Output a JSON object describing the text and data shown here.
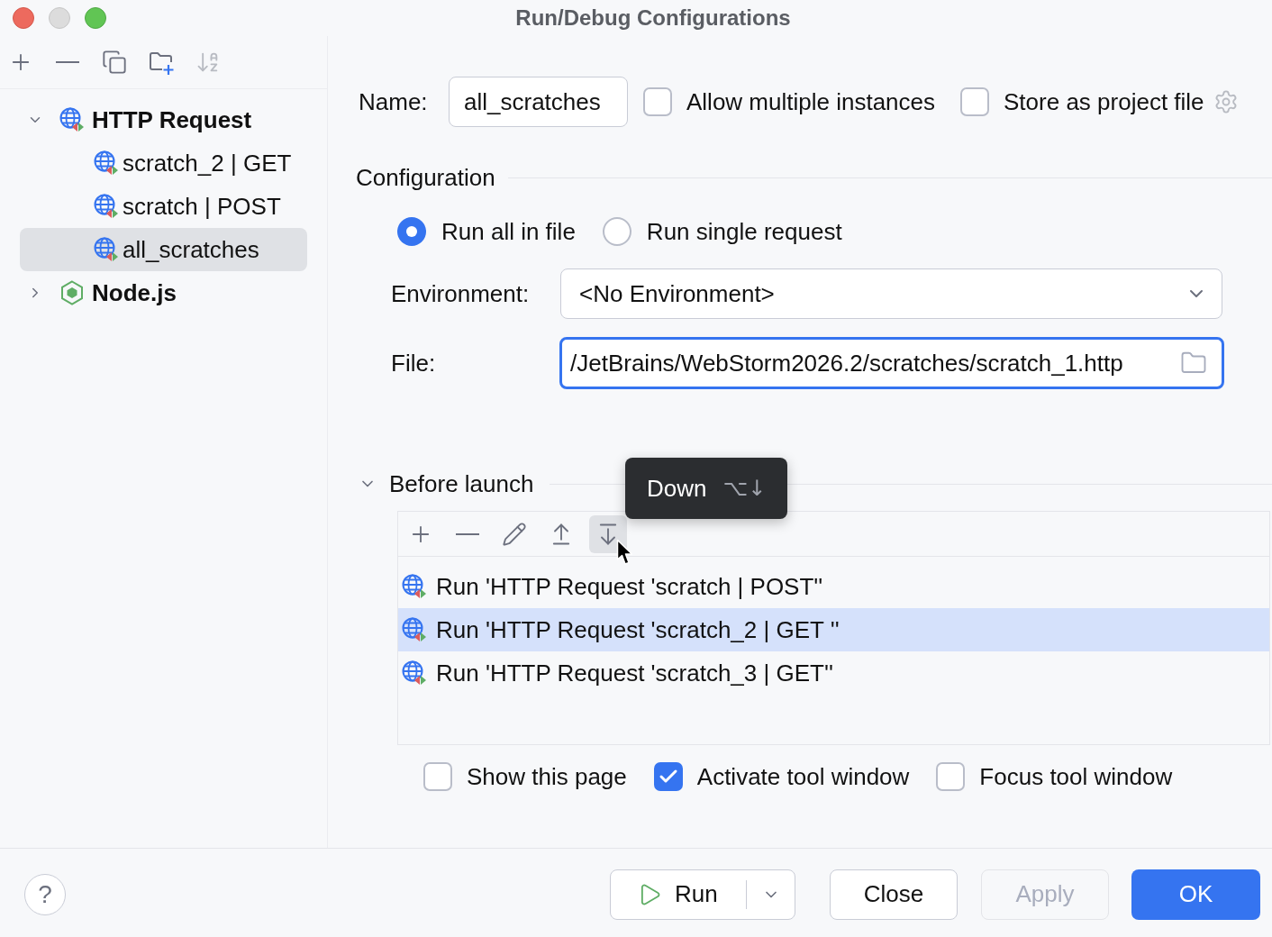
{
  "window": {
    "title": "Run/Debug Configurations"
  },
  "sidebar": {
    "toolbar": [
      {
        "kind": "add",
        "disabled": false
      },
      {
        "kind": "remove",
        "disabled": false
      },
      {
        "kind": "copy",
        "disabled": false
      },
      {
        "kind": "new-folder",
        "disabled": false
      },
      {
        "kind": "sort",
        "disabled": true
      }
    ],
    "tree": [
      {
        "kind": "http",
        "label": "HTTP Request",
        "expanded": true,
        "selected": false,
        "children": [
          {
            "kind": "http",
            "label": "scratch_2 | GET",
            "selected": false
          },
          {
            "kind": "http",
            "label": "scratch | POST",
            "selected": false
          },
          {
            "kind": "http",
            "label": "all_scratches",
            "selected": true
          }
        ]
      },
      {
        "kind": "nodejs",
        "label": "Node.js",
        "expanded": false,
        "selected": false
      }
    ]
  },
  "name_row": {
    "label": "Name:",
    "value": "all_scratches",
    "options": [
      {
        "label": "Allow multiple instances",
        "checked": false
      },
      {
        "label": "Store as project file",
        "checked": false
      }
    ]
  },
  "configuration": {
    "title": "Configuration",
    "modes": [
      {
        "label": "Run all in file",
        "selected": true
      },
      {
        "label": "Run single request",
        "selected": false
      }
    ],
    "environment": {
      "label": "Environment:",
      "value": "<No Environment>"
    },
    "file": {
      "label": "File:",
      "value": "/JetBrains/WebStorm2026.2/scratches/scratch_1.http",
      "focused": true
    }
  },
  "before_launch": {
    "title": "Before launch",
    "expanded": true,
    "toolbar": [
      {
        "kind": "add",
        "hovered": false
      },
      {
        "kind": "remove",
        "hovered": false
      },
      {
        "kind": "edit",
        "hovered": false
      },
      {
        "kind": "move-up",
        "hovered": false
      },
      {
        "kind": "move-down",
        "hovered": true
      }
    ],
    "tooltip": {
      "label": "Down",
      "shortcut": "⌥↓"
    },
    "tasks": [
      {
        "label": "Run 'HTTP Request 'scratch | POST''",
        "selected": false
      },
      {
        "label": "Run 'HTTP Request 'scratch_2 | GET ''",
        "selected": true
      },
      {
        "label": "Run 'HTTP Request 'scratch_3 | GET''",
        "selected": false
      }
    ],
    "options": [
      {
        "label": "Show this page",
        "checked": false
      },
      {
        "label": "Activate tool window",
        "checked": true
      },
      {
        "label": "Focus tool window",
        "checked": false
      }
    ]
  },
  "footer": {
    "help": "?",
    "buttons": [
      {
        "kind": "split",
        "label": "Run",
        "disabled": false
      },
      {
        "kind": "default",
        "label": "Close",
        "disabled": false
      },
      {
        "kind": "default",
        "label": "Apply",
        "disabled": true
      },
      {
        "kind": "primary",
        "label": "OK",
        "disabled": false
      }
    ]
  }
}
